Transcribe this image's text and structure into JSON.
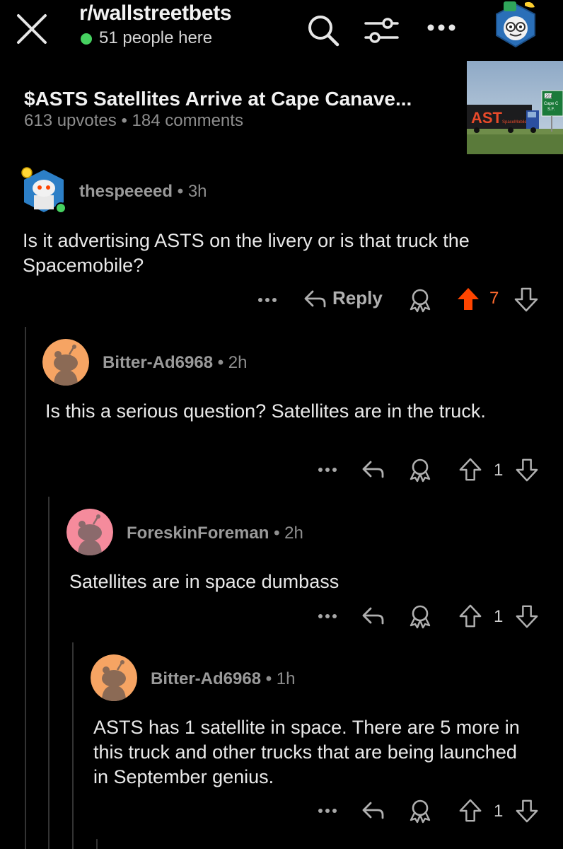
{
  "header": {
    "subreddit": "r/wallstreetbets",
    "online": "51 people here",
    "icons": [
      "close-icon",
      "search-icon",
      "filter-icon",
      "more-icon",
      "avatar-icon"
    ]
  },
  "post": {
    "title": "$ASTS Satellites Arrive at Cape Canave...",
    "upvotes": "613 upvotes",
    "separator": "•",
    "comments": "184 comments",
    "thumbnail": {
      "truck_text": "AST",
      "truck_subtext": "SpaceMobile",
      "sign_number": "201",
      "sign_text": "Cape C",
      "sign_text2": "S.F."
    }
  },
  "comments": [
    {
      "user": "thespeeeed",
      "time": "3h",
      "body": "Is it advertising ASTS on the livery or is that truck the Spacemobile?",
      "reply_label": "Reply",
      "votes": "7",
      "upvoted": true
    },
    {
      "user": "Bitter-Ad6968",
      "time": "2h",
      "body": "Is this a serious question? Satellites are in the truck.",
      "votes": "1",
      "avatar_color": "#f6a463"
    },
    {
      "user": "ForeskinForeman",
      "time": "2h",
      "body": "Satellites are in space dumbass",
      "votes": "1",
      "avatar_color": "#f58b9c"
    },
    {
      "user": "Bitter-Ad6968",
      "time": "1h",
      "body": "ASTS has 1 satellite in space. There are 5 more in this truck and other trucks that are being launched in September genius.",
      "votes": "1",
      "avatar_color": "#f6a463"
    }
  ],
  "colors": {
    "background": "#000000",
    "upvote_active": "#ff4500",
    "online": "#46d160",
    "thread_line": "#333333"
  }
}
